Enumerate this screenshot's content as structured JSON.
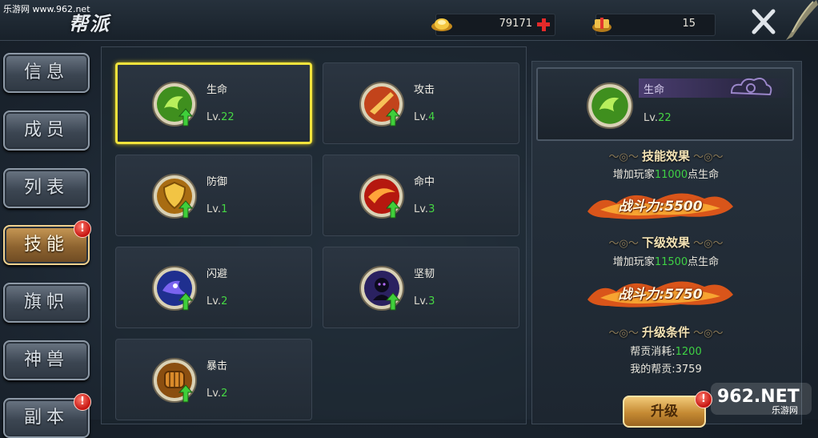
{
  "watermark": "乐游网 www.962.net",
  "window_title": "帮派",
  "currencies": [
    {
      "icon": "gold-ingot-icon",
      "value": "79171"
    },
    {
      "icon": "gift-box-icon",
      "value": "15"
    }
  ],
  "nav": [
    {
      "label": "信息",
      "active": false,
      "badge": false
    },
    {
      "label": "成员",
      "active": false,
      "badge": false
    },
    {
      "label": "列表",
      "active": false,
      "badge": false
    },
    {
      "label": "技能",
      "active": true,
      "badge": true
    },
    {
      "label": "旗帜",
      "active": false,
      "badge": false
    },
    {
      "label": "神兽",
      "active": false,
      "badge": false
    },
    {
      "label": "副本",
      "active": false,
      "badge": true
    }
  ],
  "badge_text": "!",
  "level_prefix": "Lv.",
  "skills": [
    {
      "name": "生命",
      "level": "22",
      "icon": "life-skill-icon",
      "selected": true
    },
    {
      "name": "攻击",
      "level": "4",
      "icon": "attack-skill-icon",
      "selected": false
    },
    {
      "name": "防御",
      "level": "1",
      "icon": "defense-skill-icon",
      "selected": false
    },
    {
      "name": "命中",
      "level": "3",
      "icon": "hit-skill-icon",
      "selected": false
    },
    {
      "name": "闪避",
      "level": "2",
      "icon": "dodge-skill-icon",
      "selected": false
    },
    {
      "name": "坚韧",
      "level": "3",
      "icon": "toughness-skill-icon",
      "selected": false
    },
    {
      "name": "暴击",
      "level": "2",
      "icon": "crit-skill-icon",
      "selected": false
    }
  ],
  "detail": {
    "name": "生命",
    "level": "22",
    "current_title": "技能效果",
    "current_pre": "增加玩家",
    "current_value": "11000",
    "current_post": "点生命",
    "current_power": "战斗力:5500",
    "next_title": "下级效果",
    "next_pre": "增加玩家",
    "next_value": "11500",
    "next_post": "点生命",
    "next_power": "战斗力:5750",
    "cond_title": "升级条件",
    "cost_label": "帮贡消耗:",
    "cost_value": "1200",
    "own_label": "我的帮贡:",
    "own_value": "3759",
    "upgrade_label": "升级"
  },
  "logo_text": "962.NET",
  "logo_sub": "乐游网",
  "colors": {
    "highlight_green": "#46d844",
    "selected_border": "#f2e33c",
    "active_nav": "#c99a56",
    "badge_red": "#c5130f"
  }
}
